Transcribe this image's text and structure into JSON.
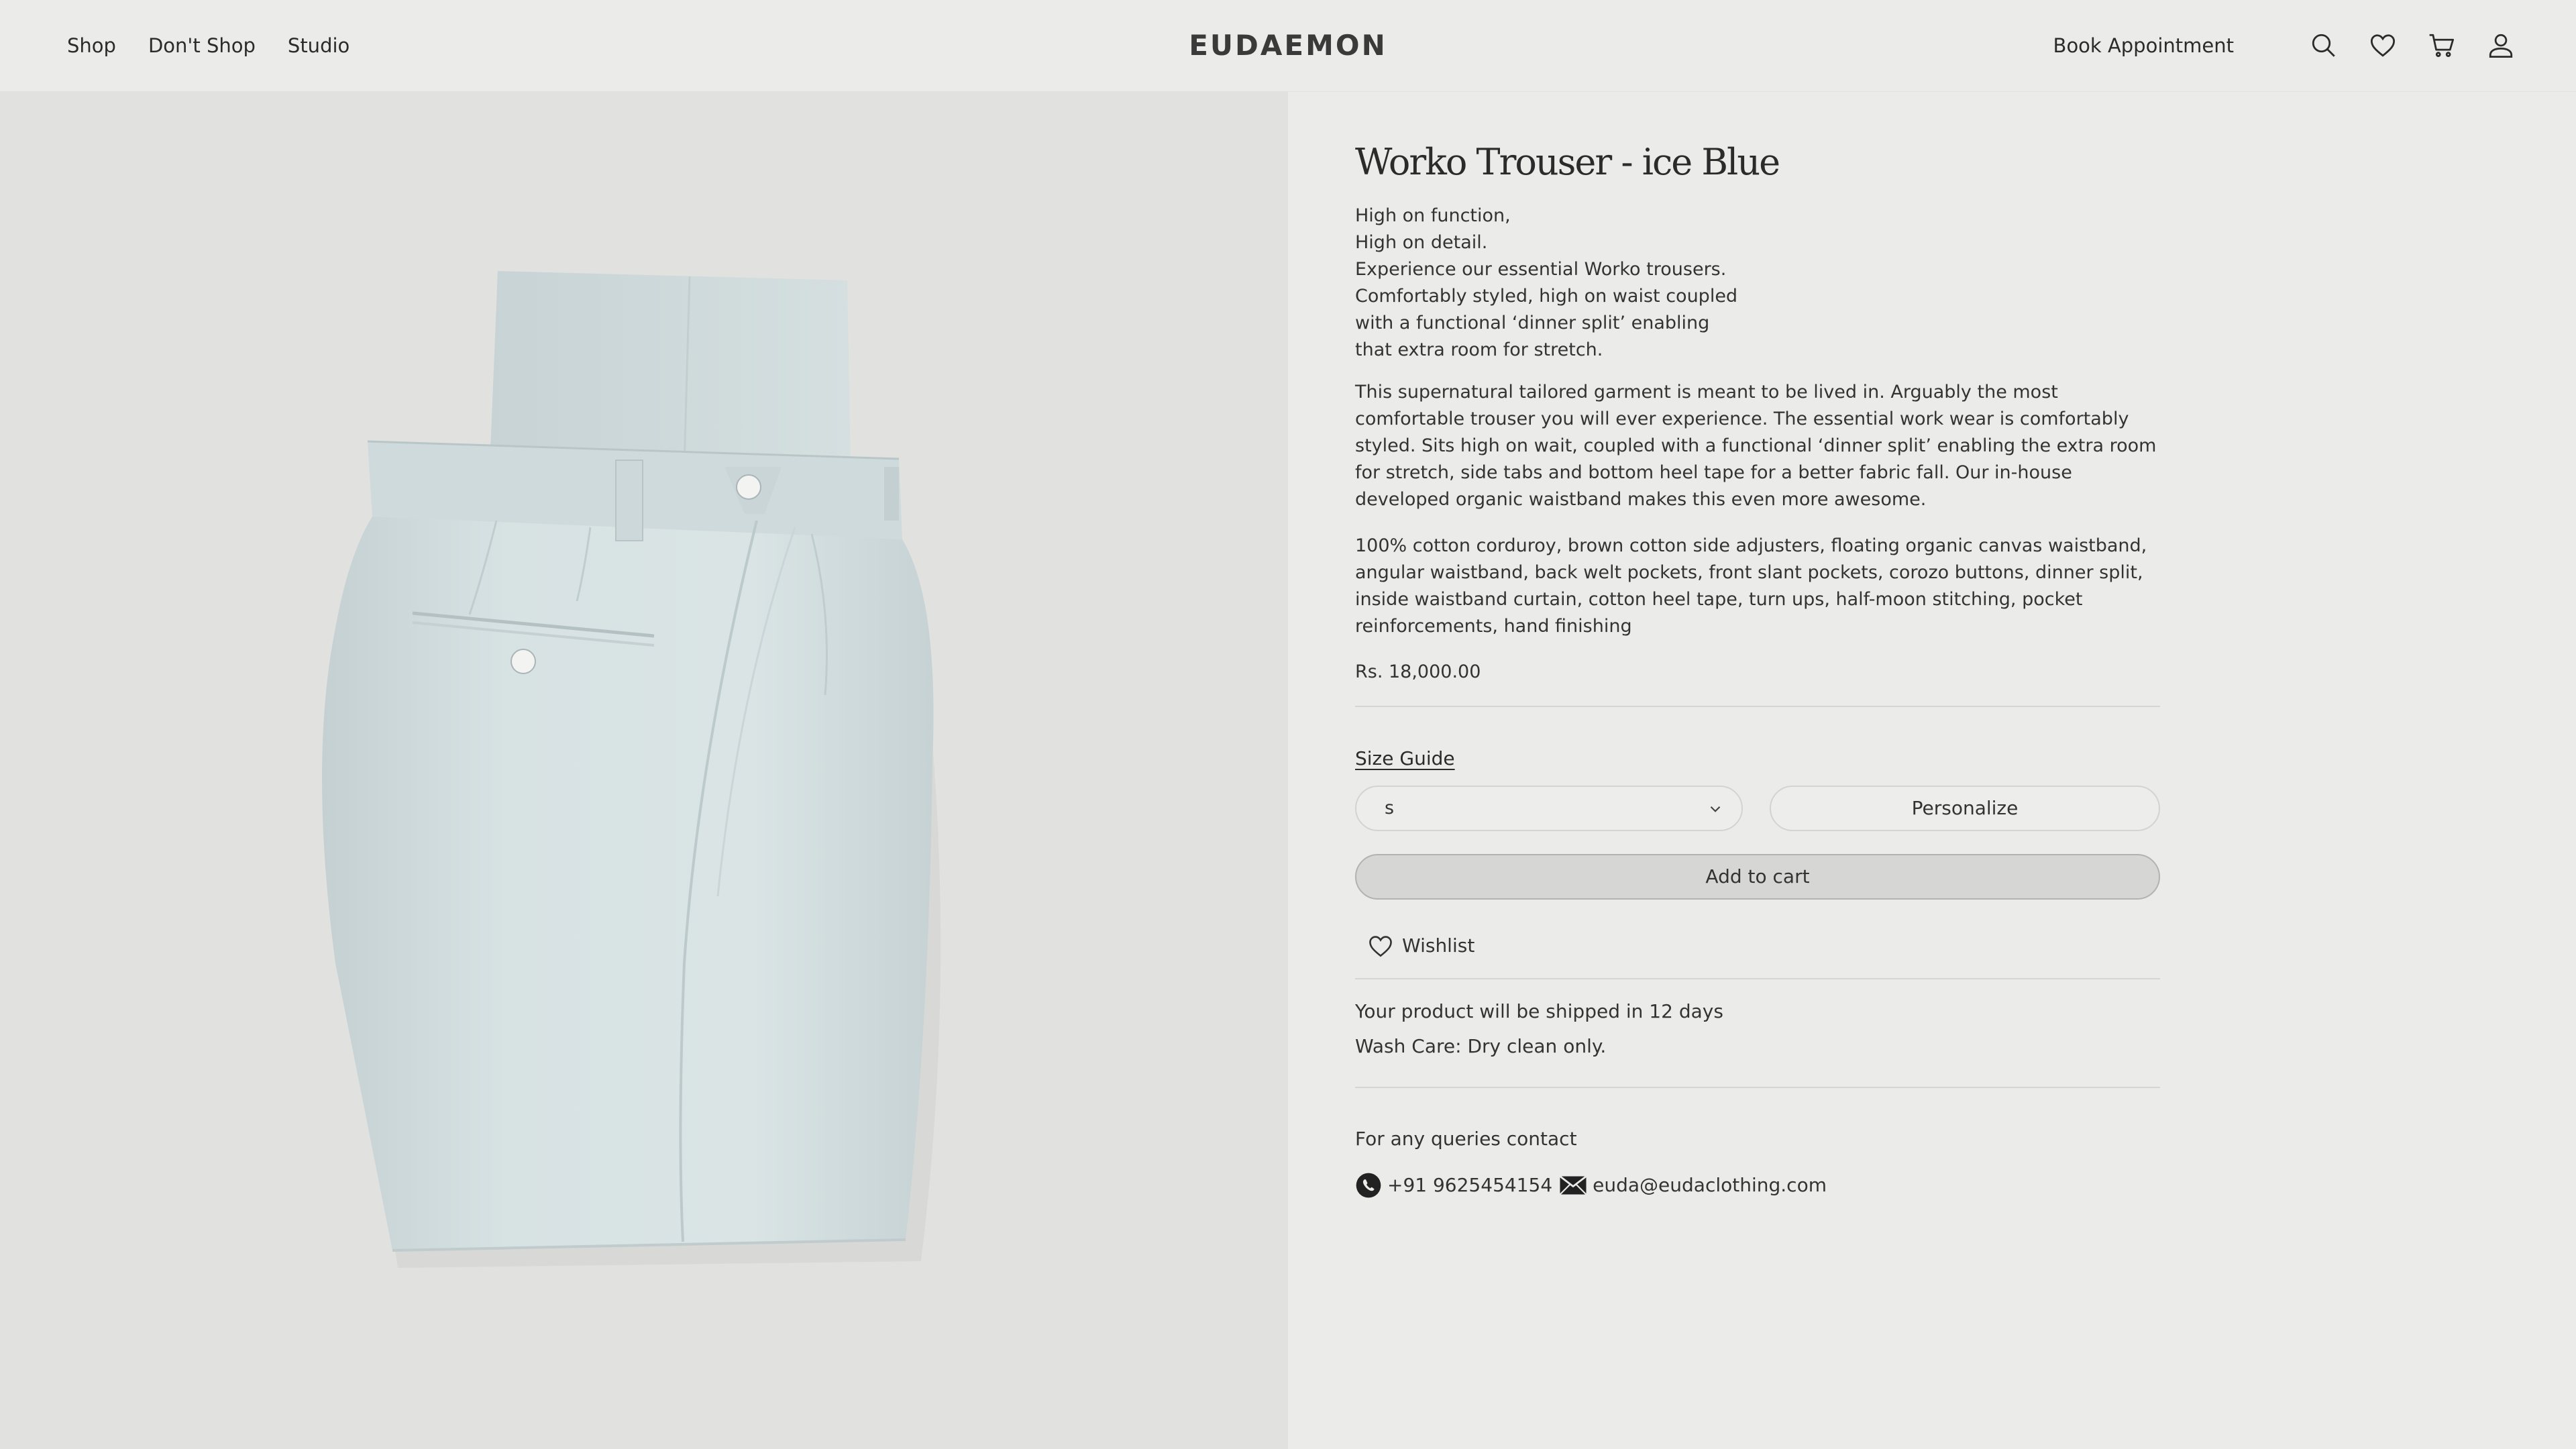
{
  "header": {
    "nav": [
      "Shop",
      "Don't Shop",
      "Studio"
    ],
    "logo": "EUDAEMON",
    "book_appointment": "Book Appointment",
    "icons": [
      "search-icon",
      "heart-icon",
      "cart-icon",
      "user-icon"
    ]
  },
  "product": {
    "title": "Worko Trouser - ice Blue",
    "tagline": [
      "High on function,",
      "High on detail.",
      "Experience our essential Worko trousers.",
      "Comfortably styled, high on waist coupled",
      "with a functional ‘dinner split’ enabling",
      "that extra room for stretch."
    ],
    "description": "This supernatural tailored garment is meant to be lived in. Arguably the most comfortable trouser you will ever experience. The essential work wear is comfortably styled. Sits high on wait, coupled with a functional ‘dinner split’ enabling the extra room for stretch, side tabs and bottom heel tape for a better fabric fall. Our in-house developed organic waistband makes this even more awesome.",
    "materials": "100% cotton corduroy, brown cotton side adjusters, floating organic canvas waistband, angular waistband, back welt pockets, front slant pockets, corozo buttons, dinner split, inside waistband curtain, cotton heel tape, turn ups, half-moon stitching, pocket reinforcements, hand finishing",
    "price": "Rs. 18,000.00"
  },
  "actions": {
    "size_guide": "Size Guide",
    "size_selected": "s",
    "personalize": "Personalize",
    "add_to_cart": "Add to cart",
    "wishlist": "Wishlist"
  },
  "info": {
    "shipping": "Your product will be shipped in 12 days",
    "wash_care": "Wash Care: Dry clean only.",
    "queries": "For any queries contact",
    "phone": "+91 9625454154",
    "email": "euda@eudaclothing.com"
  },
  "colors": {
    "page_bg": "#ebebea",
    "image_bg": "#e1e1df",
    "trouser": "#d3dfe0",
    "text": "#2b2b2b",
    "button_bg": "#d6d6d4"
  }
}
